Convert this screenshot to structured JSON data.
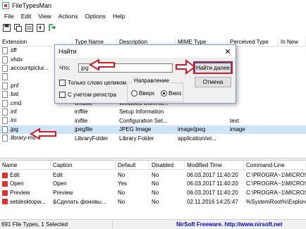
{
  "window": {
    "title": "FileTypesMan"
  },
  "menu": [
    "File",
    "Edit",
    "View",
    "Actions",
    "Options",
    "Help"
  ],
  "toolbar": [
    "save-icon",
    "copy-icon",
    "properties-icon",
    "refresh-icon",
    "exit-icon"
  ],
  "columns": [
    "Extension",
    "Type Name",
    "Description",
    "MIME Type",
    "Perceived Type",
    "In New"
  ],
  "rows": [
    {
      "ext": ".tiff",
      "type": "",
      "desc": "",
      "mime": "",
      "perceived": "ge"
    },
    {
      "ext": ".vhdx",
      "type": "",
      "desc": "",
      "mime": "",
      "perceived": ""
    },
    {
      "ext": ".accountpictur...",
      "type": "",
      "desc": "",
      "mime": "",
      "perceived": ""
    },
    {
      "ext": "",
      "type": "",
      "desc": "",
      "mime": "",
      "perceived": ""
    },
    {
      "ext": ".pnf",
      "type": "",
      "desc": "",
      "mime": "",
      "perceived": ""
    },
    {
      "ext": ".bat",
      "type": "",
      "desc": "",
      "mime": "",
      "perceived": ""
    },
    {
      "ext": ".cmd",
      "type": "cmdfile",
      "desc": "Windows Comma...",
      "mime": "",
      "perceived": ""
    },
    {
      "ext": ".inf",
      "type": "inffile",
      "desc": "Setup Information",
      "mime": "",
      "perceived": ""
    },
    {
      "ext": ".ini",
      "type": "inifile",
      "desc": "Configuration Set...",
      "mime": "",
      "perceived": "text"
    },
    {
      "ext": ".jpg",
      "type": "jpegfile",
      "desc": "JPEG Image",
      "mime": "image/jpeg",
      "perceived": "image"
    },
    {
      "ext": ".library-ms",
      "type": "LibraryFolder",
      "desc": "Library Folder",
      "mime": "application/wi...",
      "perceived": ""
    }
  ],
  "dialog": {
    "title": "Найти",
    "close": "✕",
    "what_label": "Что:",
    "query": "jpg",
    "find_next": "Найти далее",
    "cancel": "Отмена",
    "whole_word": "Только слово целиком",
    "match_case": "С учетом регистра",
    "direction": "Направление",
    "up": "Вверх",
    "down": "Вниз"
  },
  "lower_columns": [
    "Name",
    "Caption",
    "Default",
    "Disabled",
    "Modified Time",
    "Command-Line"
  ],
  "actions": [
    {
      "name": "Edit",
      "caption": "Edit",
      "def": "No",
      "dis": "No",
      "time": "06.03.2017 11:40:20",
      "cmd": "C:\\PROGRA~1\\MICROS"
    },
    {
      "name": "Open",
      "caption": "Open",
      "def": "Yes",
      "dis": "No",
      "time": "06.03.2017 11:40:20",
      "cmd": "C:\\PROGRA~1\\MICROS"
    },
    {
      "name": "Preview",
      "caption": "Preview",
      "def": "No",
      "dis": "No",
      "time": "06.03.2017 11:40:20",
      "cmd": "C:\\PROGRA~1\\MICROS"
    },
    {
      "name": "setdesktopw...",
      "caption": "&Сделать фоновы...",
      "def": "No",
      "dis": "No",
      "time": "02.11.2016 14:25:47",
      "cmd": "%SystemRoot%\\Explore"
    }
  ],
  "status": {
    "count": "691 File Types, 1 Selected",
    "credit": "NirSoft Freeware.  http://www.nirsoft.net"
  },
  "colors": {
    "accent": "#0078d7",
    "arrow": "#d11a2a",
    "selection": "#cde3f7"
  }
}
